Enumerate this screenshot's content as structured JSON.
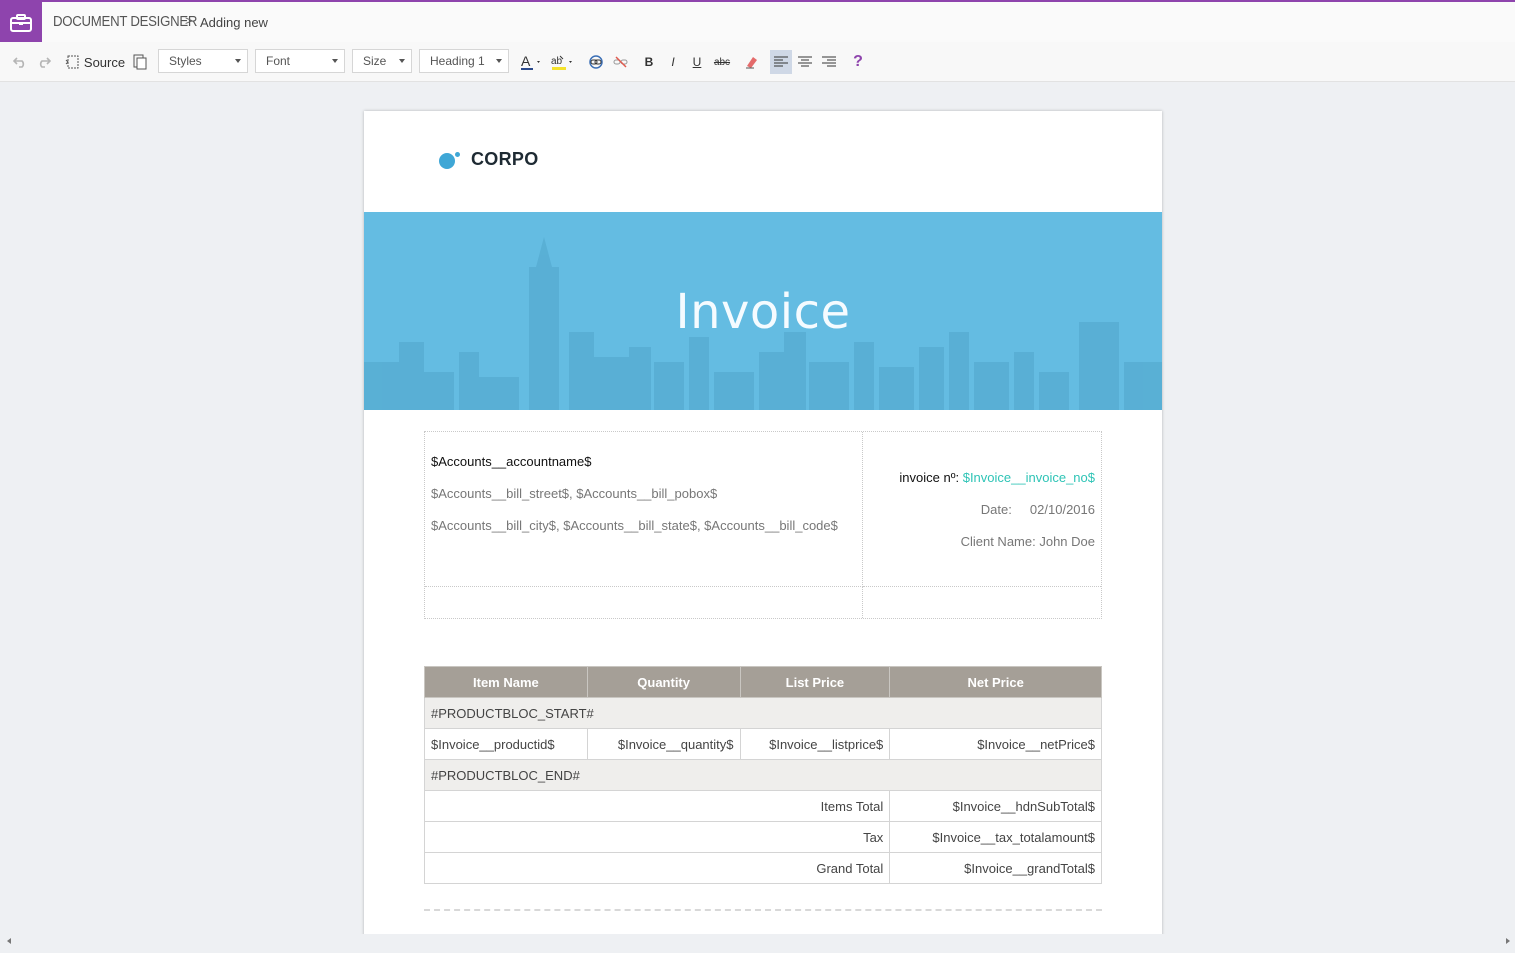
{
  "header": {
    "title": "DOCUMENT DESIGNER",
    "separator": ">",
    "subtitle": "Adding new",
    "accent_color": "#8e44ad"
  },
  "toolbar": {
    "source_label": "Source",
    "styles_label": "Styles",
    "font_label": "Font",
    "size_label": "Size",
    "format_label": "Heading 1",
    "bold_label": "B",
    "italic_label": "I",
    "underline_label": "U",
    "strike_label": "abc",
    "help_label": "?",
    "icons": [
      "undo-icon",
      "redo-icon",
      "source-icon",
      "templates-icon",
      "text-color-icon",
      "bg-color-icon",
      "link-icon",
      "unlink-icon",
      "remove-format-icon",
      "align-left-icon",
      "align-center-icon",
      "align-right-icon",
      "help-icon"
    ]
  },
  "document": {
    "logo_text": "CORPO",
    "logo_color": "#3fa7d6",
    "banner_title": "Invoice",
    "banner_color": "#64bce2",
    "account": {
      "name": "$Accounts__accountname$",
      "line1": "$Accounts__bill_street$, $Accounts__bill_pobox$",
      "line2": "$Accounts__bill_city$, $Accounts__bill_state$, $Accounts__bill_code$"
    },
    "invoice": {
      "no_label": "invoice nº:",
      "no_value": "$Invoice__invoice_no$",
      "date_label": "Date:",
      "date_value": "02/10/2016",
      "client_label": "Client Name:",
      "client_value": "John Doe"
    },
    "table": {
      "headers": [
        "Item Name",
        "Quantity",
        "List Price",
        "Net Price"
      ],
      "bloc_start": "#PRODUCTBLOC_START#",
      "row": [
        "$Invoice__productid$",
        "$Invoice__quantity$",
        "$Invoice__listprice$",
        "$Invoice__netPrice$"
      ],
      "bloc_end": "#PRODUCTBLOC_END#",
      "totals": [
        {
          "label": "Items Total",
          "value": "$Invoice__hdnSubTotal$"
        },
        {
          "label": "Tax",
          "value": "$Invoice__tax_totalamount$"
        },
        {
          "label": "Grand Total",
          "value": "$Invoice__grandTotal$"
        }
      ]
    }
  }
}
